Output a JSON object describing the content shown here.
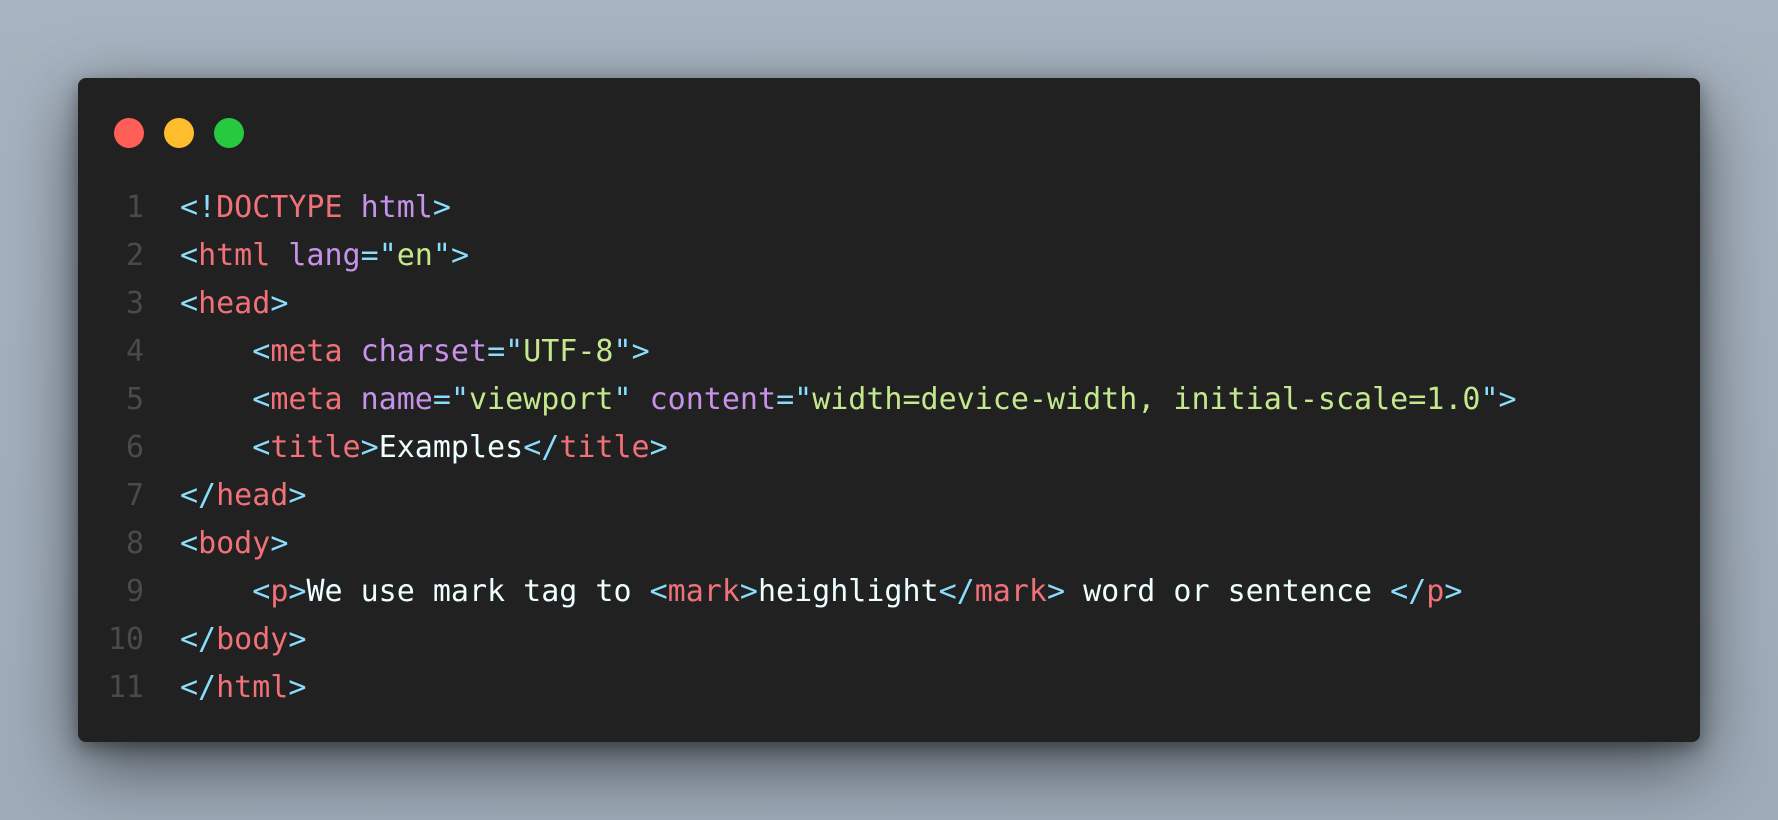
{
  "colors": {
    "bracket": "#89ddff",
    "tag": "#f07178",
    "attr": "#c792ea",
    "string": "#c3e88d",
    "text": "#eeffff",
    "line_number": "#4a4a4a",
    "dot_red": "#ff5f56",
    "dot_yellow": "#ffbd2e",
    "dot_green": "#27c93f"
  },
  "window_controls": [
    "close-dot",
    "minimize-dot",
    "maximize-dot"
  ],
  "lines": [
    {
      "n": "1",
      "indent": "",
      "tokens": [
        {
          "t": "<!",
          "k": "bracket"
        },
        {
          "t": "DOCTYPE",
          "k": "tag"
        },
        {
          "t": " ",
          "k": "text"
        },
        {
          "t": "html",
          "k": "attr"
        },
        {
          "t": ">",
          "k": "bracket"
        }
      ]
    },
    {
      "n": "2",
      "indent": "",
      "tokens": [
        {
          "t": "<",
          "k": "bracket"
        },
        {
          "t": "html",
          "k": "tag"
        },
        {
          "t": " ",
          "k": "text"
        },
        {
          "t": "lang",
          "k": "attr"
        },
        {
          "t": "=",
          "k": "bracket"
        },
        {
          "t": "\"",
          "k": "bracket"
        },
        {
          "t": "en",
          "k": "string"
        },
        {
          "t": "\"",
          "k": "bracket"
        },
        {
          "t": ">",
          "k": "bracket"
        }
      ]
    },
    {
      "n": "3",
      "indent": "",
      "tokens": [
        {
          "t": "<",
          "k": "bracket"
        },
        {
          "t": "head",
          "k": "tag"
        },
        {
          "t": ">",
          "k": "bracket"
        }
      ]
    },
    {
      "n": "4",
      "indent": "    ",
      "tokens": [
        {
          "t": "<",
          "k": "bracket"
        },
        {
          "t": "meta",
          "k": "tag"
        },
        {
          "t": " ",
          "k": "text"
        },
        {
          "t": "charset",
          "k": "attr"
        },
        {
          "t": "=",
          "k": "bracket"
        },
        {
          "t": "\"",
          "k": "bracket"
        },
        {
          "t": "UTF-8",
          "k": "string"
        },
        {
          "t": "\"",
          "k": "bracket"
        },
        {
          "t": ">",
          "k": "bracket"
        }
      ]
    },
    {
      "n": "5",
      "indent": "    ",
      "tokens": [
        {
          "t": "<",
          "k": "bracket"
        },
        {
          "t": "meta",
          "k": "tag"
        },
        {
          "t": " ",
          "k": "text"
        },
        {
          "t": "name",
          "k": "attr"
        },
        {
          "t": "=",
          "k": "bracket"
        },
        {
          "t": "\"",
          "k": "bracket"
        },
        {
          "t": "viewport",
          "k": "string"
        },
        {
          "t": "\"",
          "k": "bracket"
        },
        {
          "t": " ",
          "k": "text"
        },
        {
          "t": "content",
          "k": "attr"
        },
        {
          "t": "=",
          "k": "bracket"
        },
        {
          "t": "\"",
          "k": "bracket"
        },
        {
          "t": "width=device-width, initial-scale=1.0",
          "k": "string"
        },
        {
          "t": "\"",
          "k": "bracket"
        },
        {
          "t": ">",
          "k": "bracket"
        }
      ]
    },
    {
      "n": "6",
      "indent": "    ",
      "tokens": [
        {
          "t": "<",
          "k": "bracket"
        },
        {
          "t": "title",
          "k": "tag"
        },
        {
          "t": ">",
          "k": "bracket"
        },
        {
          "t": "Examples",
          "k": "text"
        },
        {
          "t": "</",
          "k": "bracket"
        },
        {
          "t": "title",
          "k": "tag"
        },
        {
          "t": ">",
          "k": "bracket"
        }
      ]
    },
    {
      "n": "7",
      "indent": "",
      "tokens": [
        {
          "t": "</",
          "k": "bracket"
        },
        {
          "t": "head",
          "k": "tag"
        },
        {
          "t": ">",
          "k": "bracket"
        }
      ]
    },
    {
      "n": "8",
      "indent": "",
      "tokens": [
        {
          "t": "<",
          "k": "bracket"
        },
        {
          "t": "body",
          "k": "tag"
        },
        {
          "t": ">",
          "k": "bracket"
        }
      ]
    },
    {
      "n": "9",
      "indent": "    ",
      "tokens": [
        {
          "t": "<",
          "k": "bracket"
        },
        {
          "t": "p",
          "k": "tag"
        },
        {
          "t": ">",
          "k": "bracket"
        },
        {
          "t": "We use mark tag to ",
          "k": "text"
        },
        {
          "t": "<",
          "k": "bracket"
        },
        {
          "t": "mark",
          "k": "tag"
        },
        {
          "t": ">",
          "k": "bracket"
        },
        {
          "t": "heighlight",
          "k": "text"
        },
        {
          "t": "</",
          "k": "bracket"
        },
        {
          "t": "mark",
          "k": "tag"
        },
        {
          "t": ">",
          "k": "bracket"
        },
        {
          "t": " word or sentence ",
          "k": "text"
        },
        {
          "t": "</",
          "k": "bracket"
        },
        {
          "t": "p",
          "k": "tag"
        },
        {
          "t": ">",
          "k": "bracket"
        }
      ]
    },
    {
      "n": "10",
      "indent": "",
      "tokens": [
        {
          "t": "</",
          "k": "bracket"
        },
        {
          "t": "body",
          "k": "tag"
        },
        {
          "t": ">",
          "k": "bracket"
        }
      ]
    },
    {
      "n": "11",
      "indent": "",
      "tokens": [
        {
          "t": "</",
          "k": "bracket"
        },
        {
          "t": "html",
          "k": "tag"
        },
        {
          "t": ">",
          "k": "bracket"
        }
      ]
    }
  ]
}
